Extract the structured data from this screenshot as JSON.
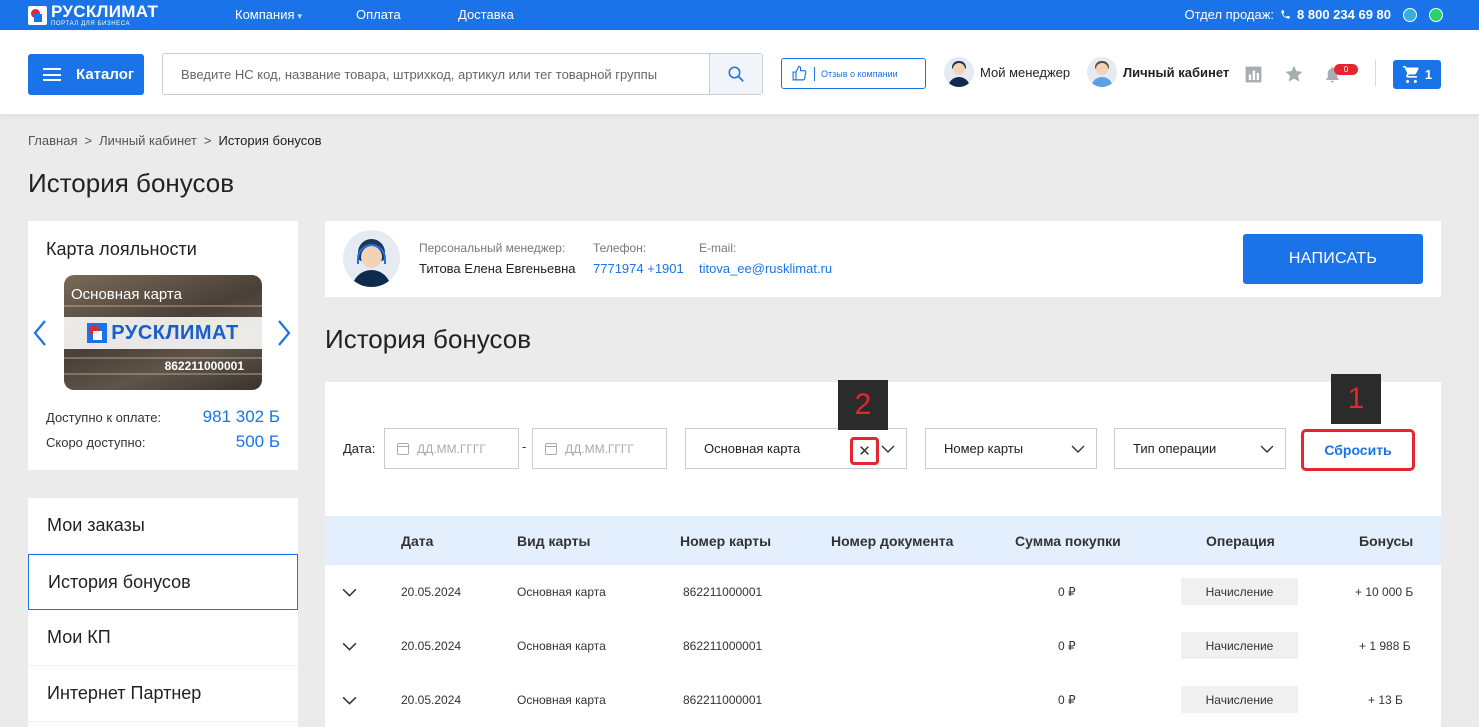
{
  "topbar": {
    "logo_name": "РУСКЛИМАТ",
    "logo_sub": "ПОРТАЛ ДЛЯ БИЗНЕСА",
    "nav": [
      "Компания",
      "Оплата",
      "Доставка"
    ],
    "sales_label": "Отдел продаж:",
    "sales_phone": "8 800 234 69 80"
  },
  "header": {
    "catalog_label": "Каталог",
    "search_placeholder": "Введите НС код, название товара, штрихкод, артикул или тег товарной группы",
    "review_label": "Отзыв о компании",
    "manager_label": "Мой менеджер",
    "cabinet_label": "Личный кабинет",
    "notif_count": "0",
    "cart_count": "1"
  },
  "breadcrumb": [
    "Главная",
    "Личный кабинет",
    "История бонусов"
  ],
  "page_title": "История бонусов",
  "loyalty": {
    "title": "Карта лояльности",
    "card_name": "Основная карта",
    "card_brand": "РУСКЛИМАТ",
    "card_number": "862211000001",
    "available_label": "Доступно к оплате:",
    "available_value": "981 302 Б",
    "soon_label": "Скоро доступно:",
    "soon_value": "500 Б"
  },
  "menu": [
    "Мои заказы",
    "История бонусов",
    "Мои КП",
    "Интернет Партнер"
  ],
  "manager": {
    "role_label": "Персональный менеджер:",
    "name": "Титова Елена Евгеньевна",
    "phone_label": "Телефон:",
    "phone": "7771974 +1901",
    "email_label": "E-mail:",
    "email": "titova_ee@rusklimat.ru",
    "write_label": "НАПИСАТЬ"
  },
  "section_title": "История бонусов",
  "filters": {
    "date_label": "Дата:",
    "date_from_placeholder": "ДД.ММ.ГГГГ",
    "date_to_placeholder": "ДД.ММ.ГГГГ",
    "card_type_value": "Основная карта",
    "card_number_label": "Номер карты",
    "operation_label": "Тип операции",
    "reset_label": "Сбросить",
    "callout_1": "1",
    "callout_2": "2"
  },
  "table": {
    "headers": [
      "Дата",
      "Вид карты",
      "Номер карты",
      "Номер документа",
      "Сумма покупки",
      "Операция",
      "Бонусы"
    ],
    "rows": [
      {
        "date": "20.05.2024",
        "card_type": "Основная карта",
        "card_number": "862211000001",
        "doc": "",
        "sum": "0 ₽",
        "operation": "Начисление",
        "bonus": "+ 10 000 Б"
      },
      {
        "date": "20.05.2024",
        "card_type": "Основная карта",
        "card_number": "862211000001",
        "doc": "",
        "sum": "0 ₽",
        "operation": "Начисление",
        "bonus": "+ 1 988 Б"
      },
      {
        "date": "20.05.2024",
        "card_type": "Основная карта",
        "card_number": "862211000001",
        "doc": "",
        "sum": "0 ₽",
        "operation": "Начисление",
        "bonus": "+ 13 Б"
      }
    ]
  },
  "colors": {
    "brand_blue": "#1a73e8",
    "accent_red": "#e3262f",
    "table_header_bg": "#e3effc"
  }
}
